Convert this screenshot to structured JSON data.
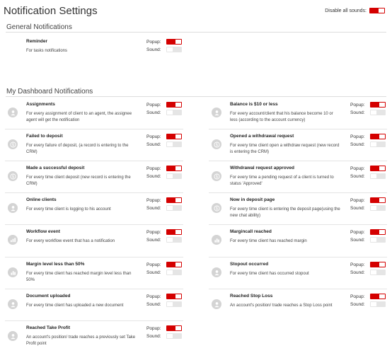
{
  "header": {
    "title": "Notification Settings",
    "disable_all_label": "Disable all sounds:",
    "disable_all_on": true
  },
  "labels": {
    "popup": "Popup:",
    "sound": "Sound:"
  },
  "general": {
    "title": "General Notifications",
    "items": [
      {
        "name": "Reminder",
        "desc": "For tasks notifications",
        "popup": true,
        "sound": false
      }
    ]
  },
  "dashboard": {
    "title": "My Dashboard Notifications",
    "left": [
      {
        "name": "Assignments",
        "desc": "For every assignment of client to an agent, the assignee agent will get the notification",
        "icon": "user-icon",
        "popup": true,
        "sound": false
      },
      {
        "name": "Failed to deposit",
        "desc": "For every failure of deposit, (a record is entering to the CRM)",
        "icon": "dollar-icon",
        "popup": true,
        "sound": false
      },
      {
        "name": "Made a successful deposit",
        "desc": "For every time client deposit (new record is entering the CRM)",
        "icon": "dollar-icon",
        "popup": true,
        "sound": false
      },
      {
        "name": "Online clients",
        "desc": "For every time client is logging to his account",
        "icon": "user-icon",
        "popup": true,
        "sound": false
      },
      {
        "name": "Workflow event",
        "desc": "For every workflow event that has a notification",
        "icon": "workflow-icon",
        "popup": true,
        "sound": false
      },
      {
        "name": "Margin level less than 50%",
        "desc": "For every time client has reached margin level less than 50%",
        "icon": "chart-icon",
        "popup": true,
        "sound": false
      },
      {
        "name": "Document uploaded",
        "desc": "For every time client has uploaded a new document",
        "icon": "user-icon",
        "popup": true,
        "sound": false
      },
      {
        "name": "Reached Take Profit",
        "desc": "An account's position/ trade reaches a previously set Take Profit point",
        "icon": "user-icon",
        "popup": true,
        "sound": false
      }
    ],
    "right": [
      {
        "name": "Balance is $10 or less",
        "desc": "For every account/client that his balance become 10 or less (according to the account currency)",
        "icon": "user-icon",
        "popup": true,
        "sound": false
      },
      {
        "name": "Opened a withdrawal request",
        "desc": "For every time client open a withdraw request (new record is entering the CRM)",
        "icon": "dollar-icon",
        "popup": true,
        "sound": false
      },
      {
        "name": "Withdrawal request approved",
        "desc": "For every time a pending request of a client is turned to status 'Approved'",
        "icon": "dollar-icon",
        "popup": true,
        "sound": false
      },
      {
        "name": "Now in deposit page",
        "desc": "For every time client is entering the deposit page(using the new chat ability)",
        "icon": "dollar-icon",
        "popup": true,
        "sound": false
      },
      {
        "name": "Margincall reached",
        "desc": "For every time client has reached margin",
        "icon": "chart-icon",
        "popup": true,
        "sound": false
      },
      {
        "name": "Stopout occurred",
        "desc": "For every time client has occurred stopout",
        "icon": "user-icon",
        "popup": true,
        "sound": false
      },
      {
        "name": "Reached Stop Loss",
        "desc": "An account's position/ trade reaches a Stop Loss point",
        "icon": "user-icon",
        "popup": true,
        "sound": false
      }
    ]
  }
}
